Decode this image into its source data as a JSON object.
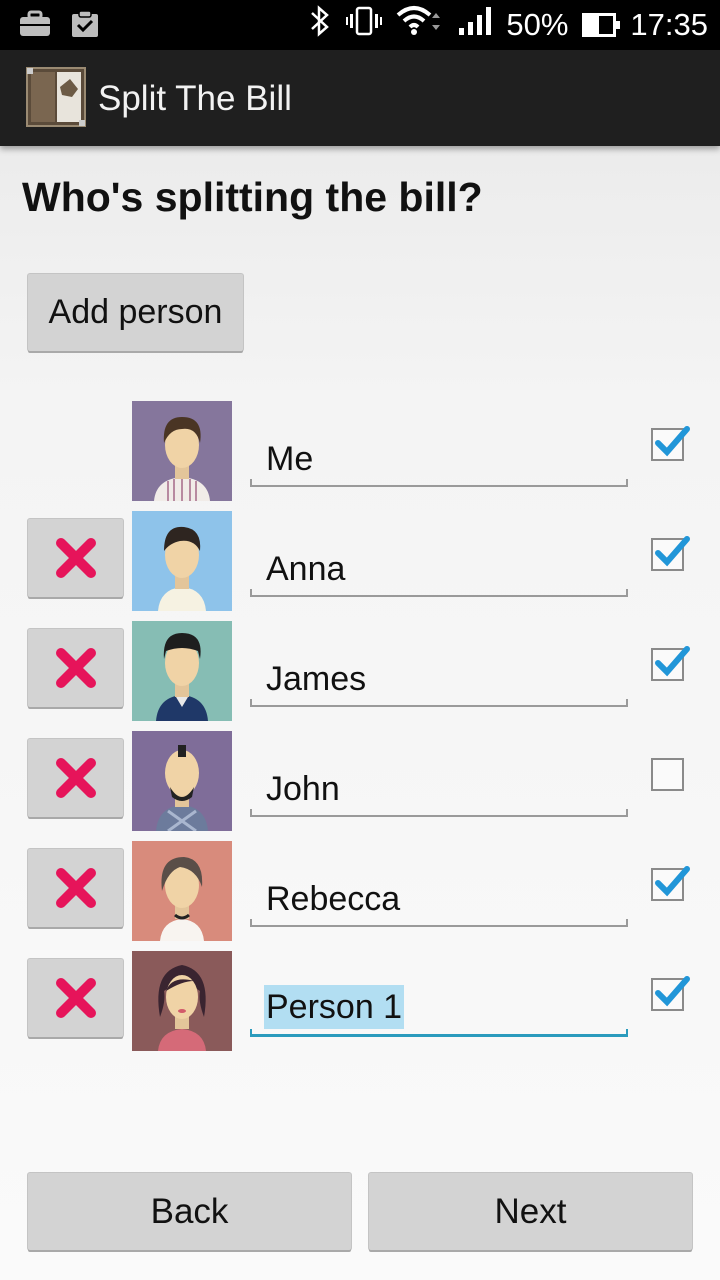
{
  "status_bar": {
    "battery": "50%",
    "battery_level": 0.5,
    "time": "17:35",
    "icons": [
      "briefcase-icon",
      "clipboard-check-icon",
      "bluetooth-icon",
      "vibrate-icon",
      "wifi-icon",
      "signal-icon",
      "battery-icon"
    ]
  },
  "action_bar": {
    "title": "Split The Bill",
    "icon": "app-logo-icon"
  },
  "main": {
    "heading": "Who's splitting the bill?",
    "add_person_label": "Add person"
  },
  "people": [
    {
      "name": "Me",
      "checked": true,
      "deletable": false,
      "avatar_bg": "#85769c"
    },
    {
      "name": "Anna",
      "checked": true,
      "deletable": true,
      "avatar_bg": "#8ec3ea"
    },
    {
      "name": "James",
      "checked": true,
      "deletable": true,
      "avatar_bg": "#86bdb4"
    },
    {
      "name": "John",
      "checked": false,
      "deletable": true,
      "avatar_bg": "#7f6d99"
    },
    {
      "name": "Rebecca",
      "checked": true,
      "deletable": true,
      "avatar_bg": "#d88b7c"
    },
    {
      "name": "Person 1",
      "checked": true,
      "deletable": true,
      "avatar_bg": "#8a5a5a",
      "focused": true
    }
  ],
  "footer": {
    "back_label": "Back",
    "next_label": "Next"
  },
  "colors": {
    "accent": "#2b9bbd",
    "delete_x": "#e6145a",
    "check": "#2196d8"
  }
}
